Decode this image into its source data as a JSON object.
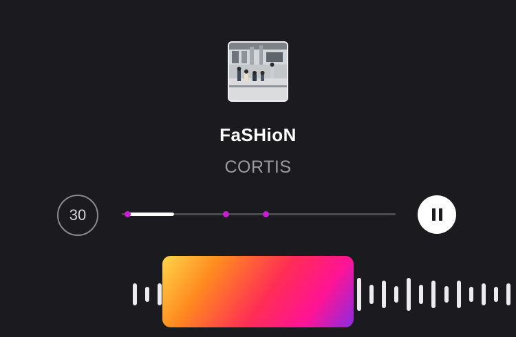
{
  "song": {
    "title": "FaSHioN",
    "artist": "CORTIS"
  },
  "player": {
    "duration_label": "30",
    "progress_fraction": 0.19,
    "markers": [
      0.02,
      0.38,
      0.525
    ],
    "state": "playing"
  },
  "colors": {
    "background": "#1b1b1f",
    "marker": "#c51fd0",
    "frame_gradient": [
      "#ffd54a",
      "#ff8a1f",
      "#ff2d55",
      "#ff1493",
      "#8a2be2"
    ]
  },
  "icons": {
    "pause": "pause-icon",
    "album": "album-cover"
  },
  "waveform": {
    "bar_heights": [
      32,
      22,
      32,
      22,
      40,
      24,
      48,
      28,
      40,
      24,
      48,
      28,
      40,
      24,
      48,
      28,
      40,
      24,
      48,
      28,
      40,
      24,
      48,
      28,
      40,
      24,
      40,
      22,
      32,
      22,
      32,
      22,
      32,
      22,
      32,
      22,
      32,
      22,
      32,
      22,
      32,
      22,
      32
    ]
  }
}
